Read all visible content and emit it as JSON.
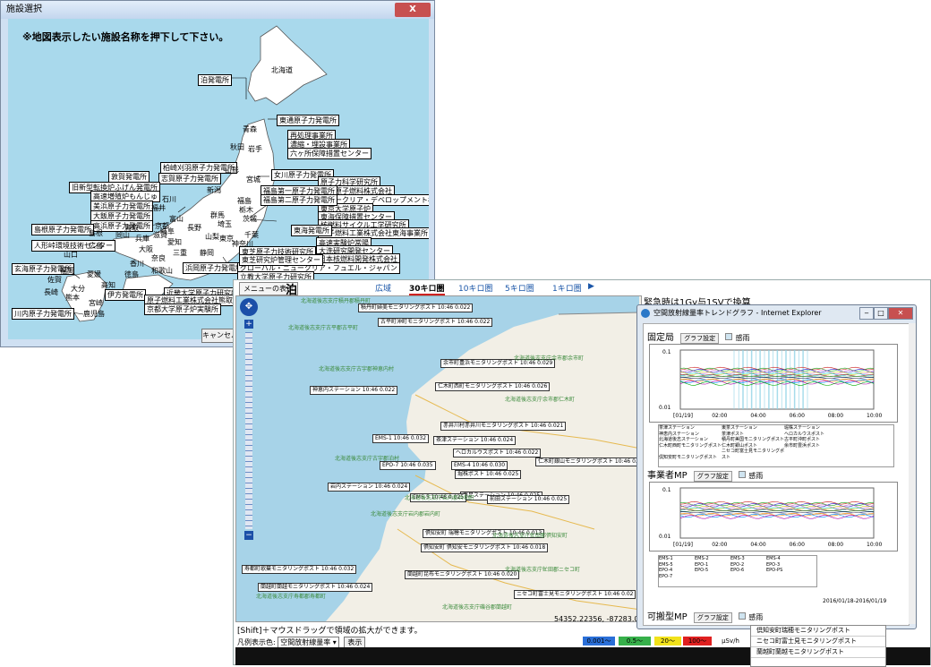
{
  "facility_window": {
    "title": "施設選択",
    "close_label": "X",
    "instruction": "※地図表示したい施設名称を押下して下さい。",
    "cancel_label": "キャンセル",
    "plants": [
      "泊発電所",
      "東通原子力発電所",
      "再処理事業所",
      "濃縮・埋設事業所",
      "六ヶ所保障措置センター",
      "女川原子力発電所",
      "原子力科学研究所",
      "三菱原子燃料株式会社",
      "ニュークリア・デベロップメント株式会社",
      "東京大学原子炉",
      "東海保障措置センター",
      "核燃料サイクル工学研究所",
      "原子燃料工業株式会社東海事業所",
      "福島第一原子力発電所",
      "福島第二原子力発電所",
      "東海発電所",
      "高速実験炉常陽",
      "大洗研究開発センター",
      "日本核燃料開発株式会社",
      "柏崎刈羽原子力発電所",
      "志賀原子力発電所",
      "敦賀発電所",
      "旧新型転換炉ふげん発電所",
      "高速増殖炉もんじゅ",
      "美浜原子力発電所",
      "大飯原子力発電所",
      "高浜原子力発電所",
      "島根原子力発電所",
      "人形峠環境技術センター",
      "玄海原子力発電所",
      "川内原子力発電所",
      "伊方発電所",
      "近畿大学原子力研究所",
      "原子燃料工業株式会社熊取事業所",
      "京都大学原子炉実験所",
      "浜岡原子力発電所",
      "グローバル・ニュークリア・フュエル・ジャパン",
      "立教大学原子力研究所",
      "東芝原子力技術研究所",
      "東芝研究炉管理センター"
    ],
    "prefs": [
      "北海道",
      "青森",
      "秋田",
      "岩手",
      "山形",
      "宮城",
      "新潟",
      "福島",
      "栃木",
      "茨城",
      "群馬",
      "埼玉",
      "千葉",
      "東京",
      "神奈川",
      "山梨",
      "静岡",
      "長野",
      "富山",
      "石川",
      "福井",
      "岐阜",
      "愛知",
      "三重",
      "滋賀",
      "京都",
      "兵庫",
      "大阪",
      "奈良",
      "和歌山",
      "鳥取",
      "岡山",
      "島根",
      "広島",
      "山口",
      "香川",
      "徳島",
      "愛媛",
      "高知",
      "福岡",
      "佐賀",
      "長崎",
      "大分",
      "熊本",
      "宮崎",
      "鹿児島"
    ]
  },
  "map_window": {
    "menu_label": "メニューの表示",
    "site_name": "泊",
    "range_tabs": [
      "広域",
      "30キロ圏",
      "10キロ圏",
      "5キロ圏",
      "1キロ圏"
    ],
    "active_tab": "30キロ圏",
    "emergency_note": "緊急時は1Gy与1SVで換算",
    "posts": [
      "積丹町婦美モニタリングポスト 10:46 0.022",
      "古平町沖町モニタリングポスト 10:46 0.022",
      "余市町豊浜モニタリングポスト 10:46 0.029",
      "仁木町西町モニタリングポスト 10:46 0.026",
      "神恵内ステーション 10:46 0.022",
      "赤井川村赤井川モニタリングポスト 10:46 0.021",
      "茶津ステーション 10:46 0.024",
      "ヘロカルウスポスト 10:46 0.022",
      "EMS-1 10:46 0.032",
      "EMS-4 10:46 0.030",
      "仁木町銀山モニタリングポスト 10:46 0.025",
      "堀株ポスト 10:46 0.025",
      "EPO-7 10:46 0.035",
      "発足ステーション 10:46 0.025",
      "岩内ステーション 10:46 0.024",
      "EMS-5 10:46 0.025",
      "前田ステーション 10:46 0.025",
      "倶知安町 瑞穂モニタリングポスト 10:46 0.013",
      "倶知安町 倶知安モニタリングポスト 10:46 0.018",
      "寿都町歌棄モニタリングポスト 10:46 0.032",
      "蘭越町蘭越モニタリングポスト 10:46 0.024",
      "蘭越町昆布モニタリングポスト 10:46 0.020",
      "ニセコ町富士見モニタリングポスト 10:46 0.02"
    ],
    "area_labels": [
      "北海道後志支庁積丹郡積丹町",
      "北海道後志支庁古平郡古平町",
      "北海道後志支庁古宇郡神恵内村",
      "北海道後志支庁余市郡余市町",
      "北海道後志支庁余市郡仁木町",
      "北海道後志支庁古宇郡泊村",
      "北海道後志支庁岩内郡共和町",
      "北海道後志支庁岩内郡岩内町",
      "北海道後志支庁虻田郡倶知安町",
      "北海道後志支庁寿都郡寿都町",
      "北海道後志支庁磯谷郡蘭越町",
      "北海道後志支庁虻田郡ニセコ町"
    ],
    "coords": "54352.22356, -87283.02320",
    "shift_hint": "[Shift]＋マウスドラッグで領域の拡大ができます。",
    "legend_label": "凡例表示色:",
    "legend_select": "空間放射線量率",
    "show_button": "表示",
    "scale_items": [
      {
        "label": "0.001〜",
        "color": "#2a6fd8"
      },
      {
        "label": "0.5〜",
        "color": "#36b04a"
      },
      {
        "label": "20〜",
        "color": "#f2e21a"
      },
      {
        "label": "100〜",
        "color": "#e02020"
      }
    ],
    "unit": "μSv/h"
  },
  "trend_window": {
    "title": "空間放射線量率トレンドグラフ - Internet Explorer",
    "sections": [
      {
        "title": "固定局",
        "graph_btn": "グラフ設定",
        "rain_label": "感雨"
      },
      {
        "title": "事業者MP",
        "graph_btn": "グラフ設定",
        "rain_label": "感雨"
      },
      {
        "title": "可搬型MP",
        "graph_btn": "グラフ設定",
        "rain_label": "感雨"
      }
    ],
    "y_top": "0.1",
    "y_bottom": "0.01",
    "x_ticks": [
      "[01/19]",
      "02:00",
      "04:00",
      "06:00",
      "08:00",
      "10:00"
    ],
    "legend1": [
      "茶津ステーション",
      "東茶ステーション",
      "堀株ステーション",
      "神恵内ステーション",
      "茶津ポスト",
      "ヘロカルウスポスト",
      "北海道後志ステーション",
      "積丹町美国モニタリングポスト",
      "古平町沖町ポスト",
      "仁木町西町モニタリングポスト",
      "仁木町銀山ポスト",
      "余市町豊浜ポスト",
      "倶知安町モニタリングポスト",
      "ニセコ町富士見モニタリングポスト"
    ],
    "legend2": [
      "EMS-1",
      "EMS-2",
      "EMS-3",
      "EMS-4",
      "EMS-5",
      "EPO-1",
      "EPO-2",
      "EPO-3",
      "EPO-4",
      "EPO-5",
      "EPO-6",
      "EPO-PS",
      "EPO-7"
    ],
    "date_range": "2016/01/18-2016/01/19"
  },
  "bottom_list": [
    "倶知安町瑞穂モニタリングポスト",
    "ニセコ町富士見モニタリングポスト",
    "蘭越町蘭越モニタリングポスト"
  ]
}
